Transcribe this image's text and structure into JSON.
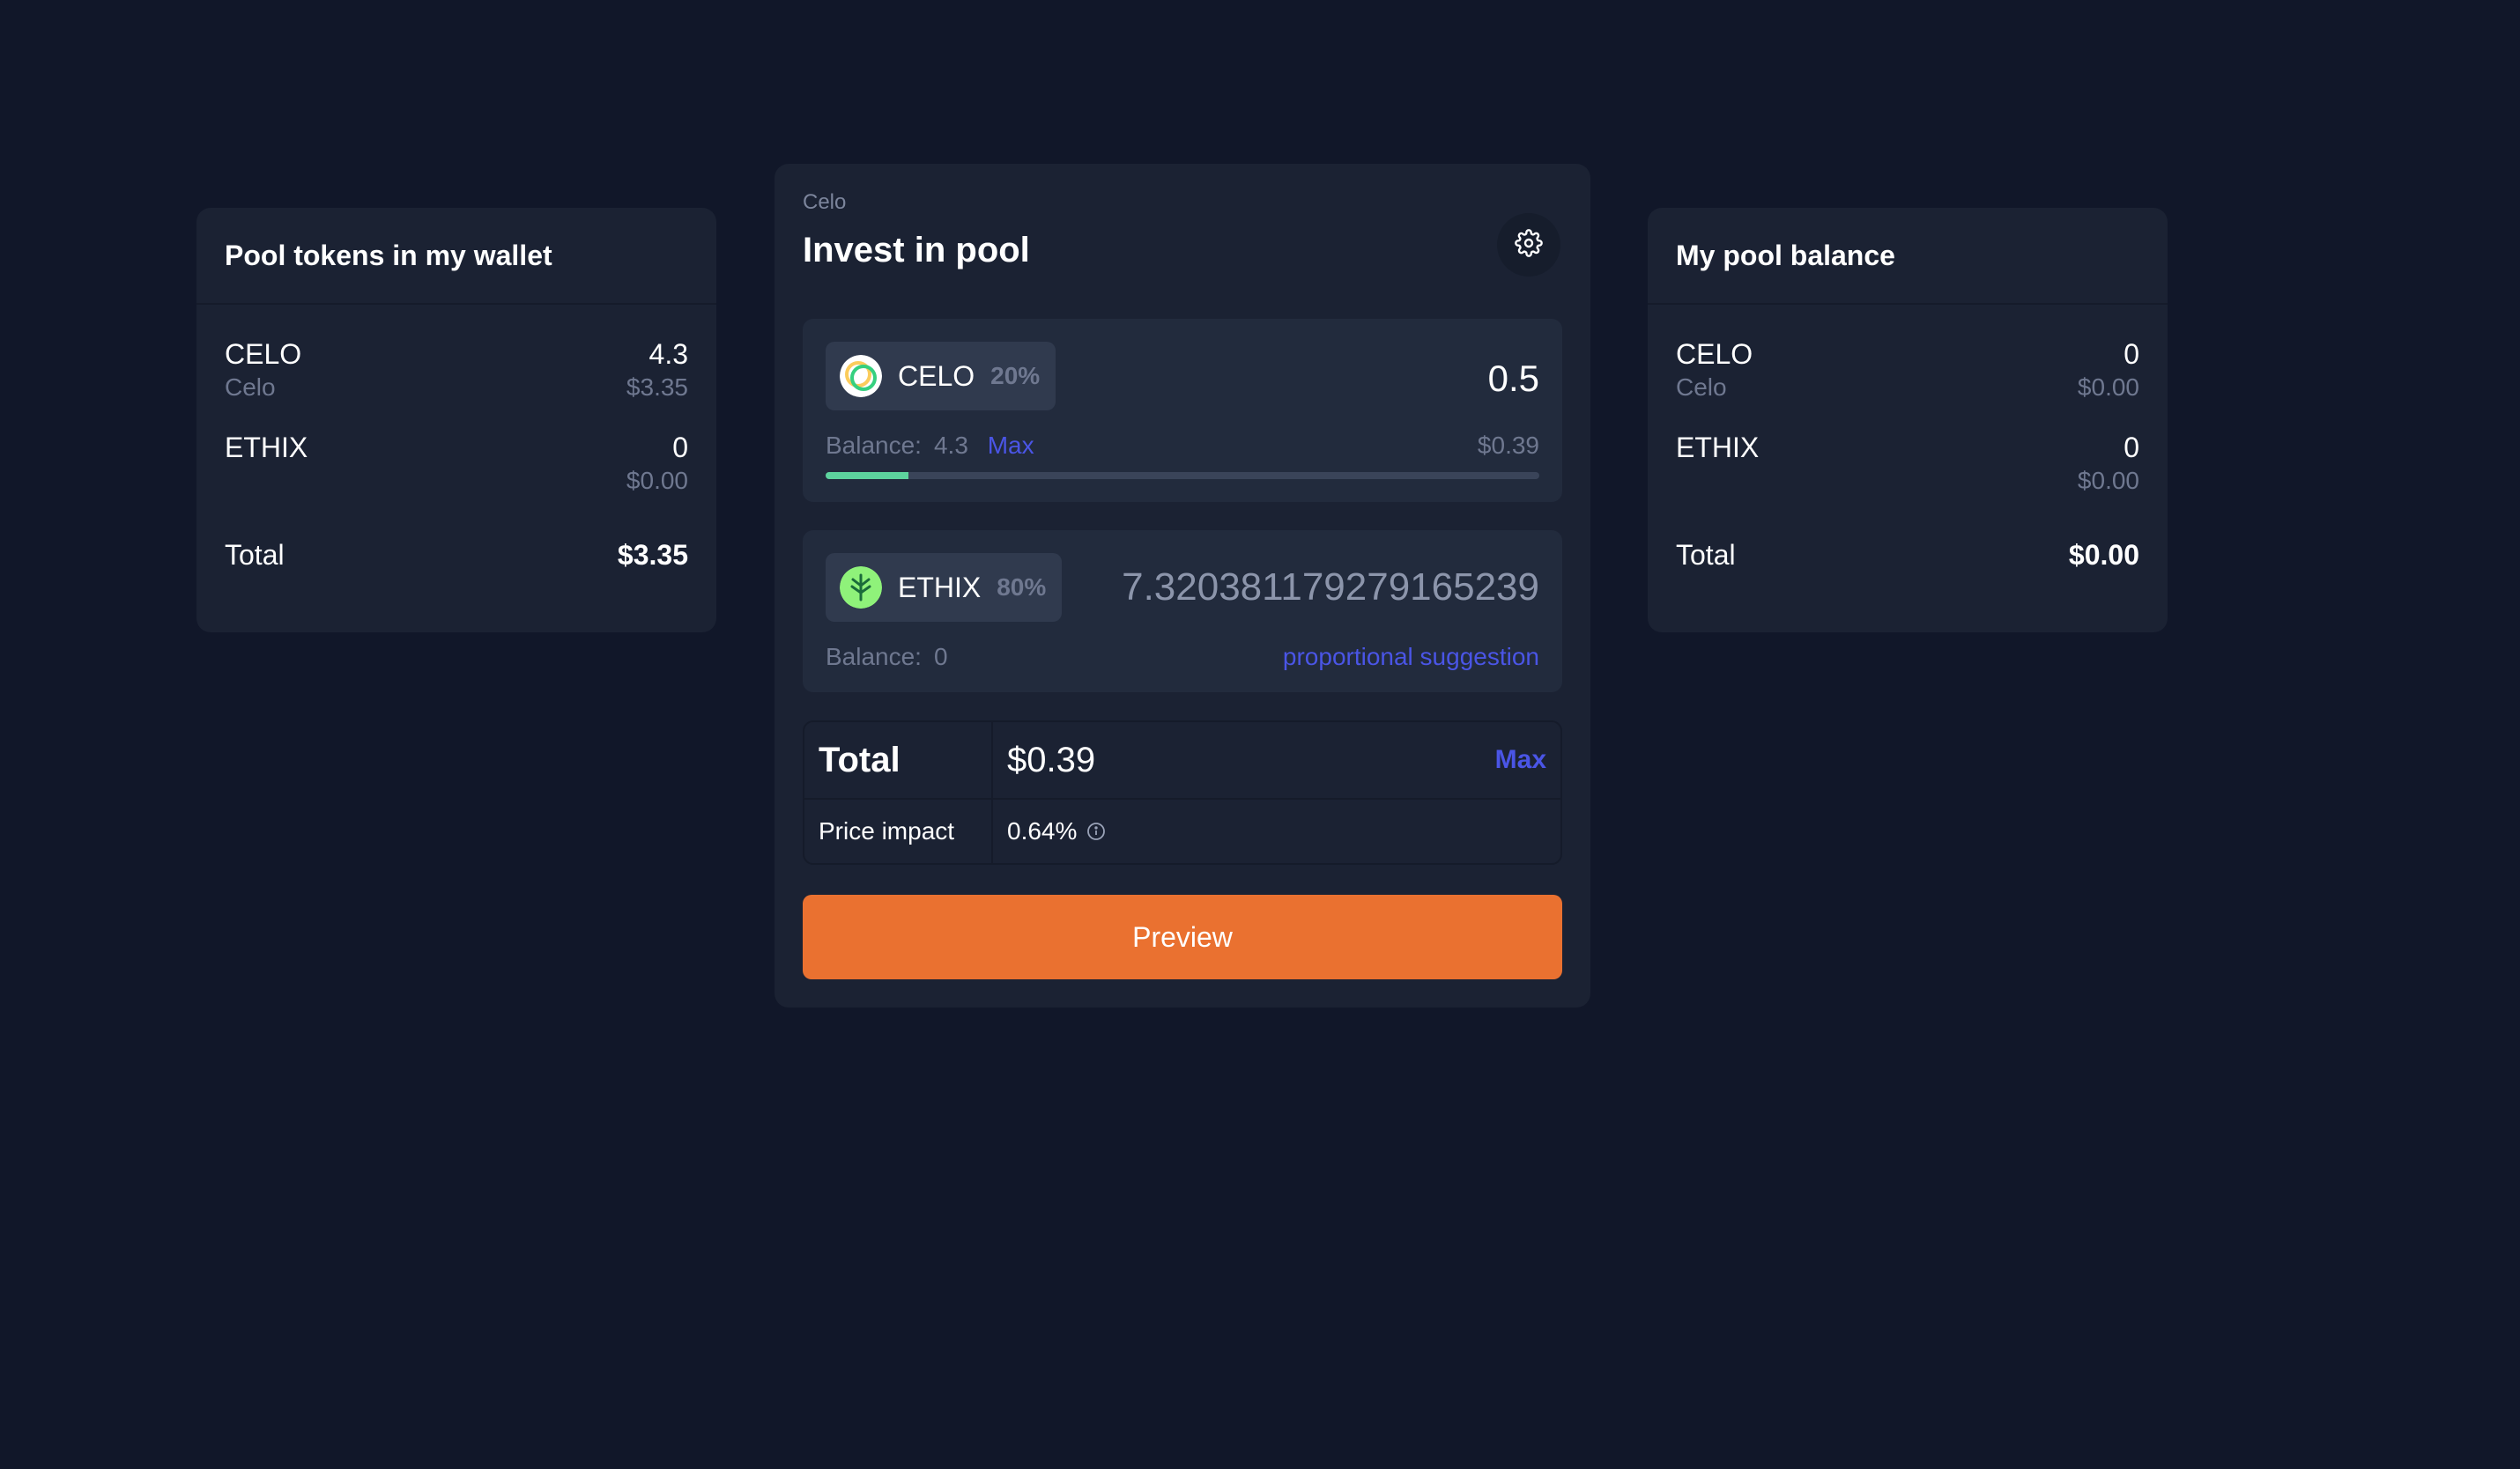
{
  "left_panel": {
    "title": "Pool tokens in my wallet",
    "tokens": [
      {
        "symbol": "CELO",
        "name": "Celo",
        "amount": "4.3",
        "usd": "$3.35"
      },
      {
        "symbol": "ETHIX",
        "name": "",
        "amount": "0",
        "usd": "$0.00"
      }
    ],
    "total_label": "Total",
    "total_value": "$3.35"
  },
  "invest": {
    "breadcrumb": "Celo",
    "title": "Invest in pool",
    "settings_icon": "gear-icon",
    "token1": {
      "symbol": "CELO",
      "weight": "20%",
      "amount": "0.5",
      "balance_label": "Balance:",
      "balance_value": "4.3",
      "max_label": "Max",
      "usd": "$0.39",
      "balance_used_fraction": 0.116,
      "bar_color": "#5dd39e"
    },
    "token2": {
      "symbol": "ETHIX",
      "weight": "80%",
      "amount": "7.320381179279165239",
      "balance_label": "Balance:",
      "balance_value": "0",
      "suggestion_label": "proportional suggestion"
    },
    "summary": {
      "total_label": "Total",
      "total_value": "$0.39",
      "max_label": "Max",
      "price_impact_label": "Price impact",
      "price_impact_value": "0.64%"
    },
    "preview_label": "Preview"
  },
  "right_panel": {
    "title": "My pool balance",
    "tokens": [
      {
        "symbol": "CELO",
        "name": "Celo",
        "amount": "0",
        "usd": "$0.00"
      },
      {
        "symbol": "ETHIX",
        "name": "",
        "amount": "0",
        "usd": "$0.00"
      }
    ],
    "total_label": "Total",
    "total_value": "$0.00"
  },
  "colors": {
    "background": "#111729",
    "card": "#1b2233",
    "accent_orange": "#ea7130",
    "link_blue": "#4a55e6",
    "progress_green": "#5dd39e"
  }
}
